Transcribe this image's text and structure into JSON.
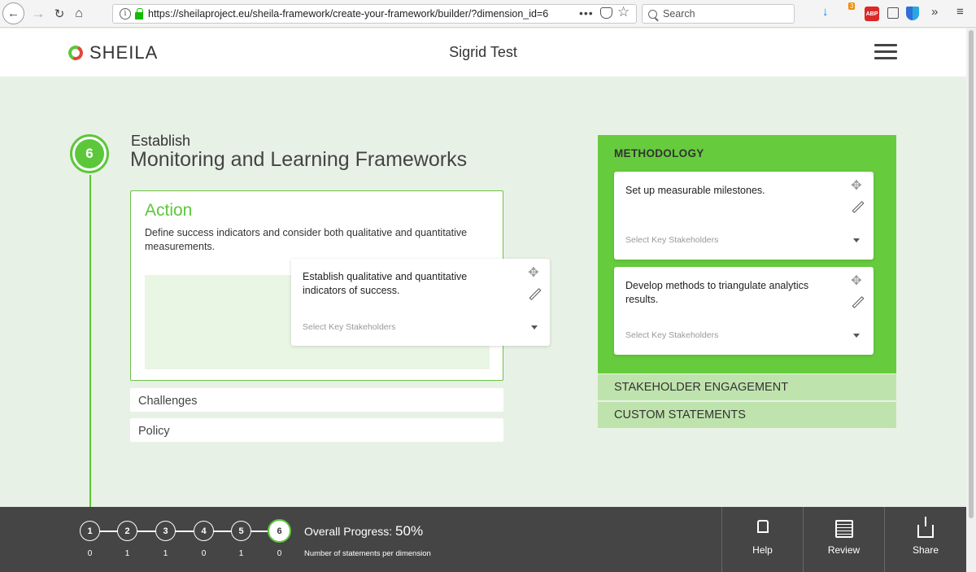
{
  "browser": {
    "url": "https://sheilaproject.eu/sheila-framework/create-your-framework/builder/?dimension_id=6",
    "search_placeholder": "Search",
    "ext_badge": "3",
    "abp_label": "ABP"
  },
  "header": {
    "logo_text": "SHEILA",
    "user_name": "Sigrid Test"
  },
  "dimension": {
    "number": "6",
    "pre_title": "Establish",
    "title": "Monitoring and Learning Frameworks"
  },
  "action": {
    "title": "Action",
    "description": "Define success indicators and consider both qualitative and quantitative measurements.",
    "dragged_statement": {
      "text": "Establish qualitative and quantitative indicators of success.",
      "select_placeholder": "Select Key Stakeholders"
    }
  },
  "sections": {
    "challenges": "Challenges",
    "policy": "Policy"
  },
  "methodology": {
    "heading": "METHODOLOGY",
    "statements": [
      {
        "text": "Set up measurable milestones.",
        "select_placeholder": "Select Key Stakeholders"
      },
      {
        "text": "Develop methods to triangulate analytics results.",
        "select_placeholder": "Select Key Stakeholders"
      }
    ],
    "tabs": {
      "stakeholder": "STAKEHOLDER ENGAGEMENT",
      "custom": "CUSTOM STATEMENTS"
    }
  },
  "progress": {
    "steps": [
      {
        "label": "1",
        "count": "0"
      },
      {
        "label": "2",
        "count": "1"
      },
      {
        "label": "3",
        "count": "1"
      },
      {
        "label": "4",
        "count": "0"
      },
      {
        "label": "5",
        "count": "1"
      },
      {
        "label": "6",
        "count": "0"
      }
    ],
    "current_step": 6,
    "overall_label": "Overall Progress:",
    "overall_value": "50%",
    "caption": "Number of statements per dimension"
  },
  "bottom_actions": {
    "help": "Help",
    "review": "Review",
    "share": "Share"
  },
  "colors": {
    "accent_green": "#5cc73a",
    "panel_green": "#66cc3d",
    "tab_green": "#bfe3ad",
    "bottom_bar": "#454545"
  }
}
